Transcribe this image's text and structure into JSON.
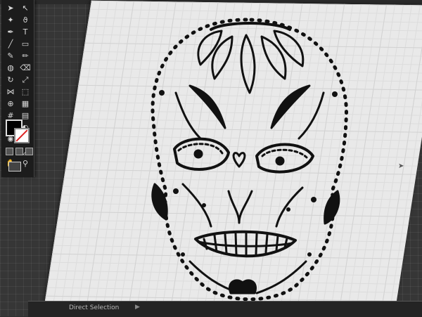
{
  "app": {
    "status_bar": {
      "tool_label": "Direct Selection"
    }
  },
  "tools_panel": {
    "tools": [
      {
        "name": "selection-tool-icon",
        "glyph": "➤"
      },
      {
        "name": "direct-selection-tool-icon",
        "glyph": "↖"
      },
      {
        "name": "magic-wand-tool-icon",
        "glyph": "✦"
      },
      {
        "name": "lasso-tool-icon",
        "glyph": "ϑ"
      },
      {
        "name": "pen-tool-icon",
        "glyph": "✒"
      },
      {
        "name": "type-tool-icon",
        "glyph": "T"
      },
      {
        "name": "line-tool-icon",
        "glyph": "╱"
      },
      {
        "name": "rectangle-tool-icon",
        "glyph": "▭"
      },
      {
        "name": "paintbrush-tool-icon",
        "glyph": "✎"
      },
      {
        "name": "pencil-tool-icon",
        "glyph": "✏"
      },
      {
        "name": "blob-brush-tool-icon",
        "glyph": "◍"
      },
      {
        "name": "eraser-tool-icon",
        "glyph": "⌫"
      },
      {
        "name": "rotate-tool-icon",
        "glyph": "↻"
      },
      {
        "name": "scale-tool-icon",
        "glyph": "⤢"
      },
      {
        "name": "width-tool-icon",
        "glyph": "⋈"
      },
      {
        "name": "free-transform-tool-icon",
        "glyph": "⬚"
      },
      {
        "name": "shape-builder-tool-icon",
        "glyph": "⊕"
      },
      {
        "name": "perspective-grid-tool-icon",
        "glyph": "▦"
      },
      {
        "name": "mesh-tool-icon",
        "glyph": "#"
      },
      {
        "name": "gradient-tool-icon",
        "glyph": "▤"
      },
      {
        "name": "eyedropper-tool-icon",
        "glyph": "⌇"
      },
      {
        "name": "blend-tool-icon",
        "glyph": "◐"
      },
      {
        "name": "symbol-sprayer-tool-icon",
        "glyph": "✺"
      },
      {
        "name": "column-graph-tool-icon",
        "glyph": "▥"
      },
      {
        "name": "artboard-tool-icon",
        "glyph": "⊞"
      },
      {
        "name": "slice-tool-icon",
        "glyph": "◿"
      },
      {
        "name": "hand-tool-icon",
        "glyph": "✋"
      },
      {
        "name": "zoom-tool-icon",
        "glyph": "⚲"
      }
    ],
    "fill_color": "#000000",
    "stroke_color": "#ffffff"
  },
  "colors": {
    "pasteboard": "#363636",
    "artboard": "#e9e9e9",
    "artwork": "#111111"
  }
}
